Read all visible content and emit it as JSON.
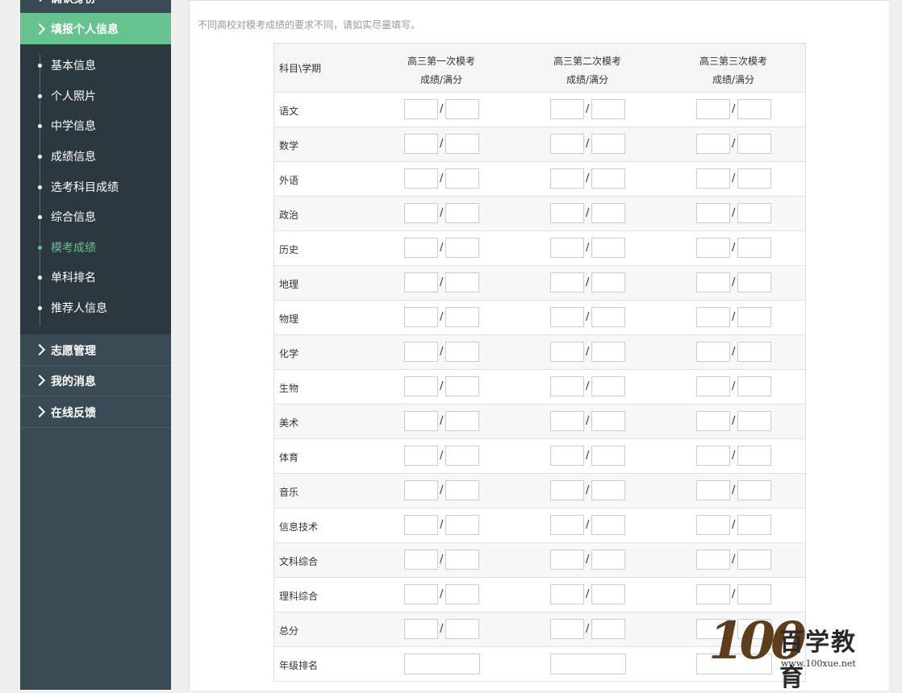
{
  "sidebar": {
    "top_partial": "确认身份",
    "active_section": "填报个人信息",
    "sub_items": [
      "基本信息",
      "个人照片",
      "中学信息",
      "成绩信息",
      "选考科目成绩",
      "综合信息",
      "模考成绩",
      "单科排名",
      "推荐人信息"
    ],
    "active_sub": "模考成绩",
    "menu": [
      "志愿管理",
      "我的消息",
      "在线反馈"
    ]
  },
  "main": {
    "note": "不同高校对模考成绩的要求不同，请如实尽量填写。",
    "table": {
      "corner": "科目\\学期",
      "columns": [
        {
          "line1": "高三第一次模考",
          "line2": "成绩/满分"
        },
        {
          "line1": "高三第二次模考",
          "line2": "成绩/满分"
        },
        {
          "line1": "高三第三次模考",
          "line2": "成绩/满分"
        }
      ],
      "separator": "/",
      "rows": [
        "语文",
        "数学",
        "外语",
        "政治",
        "历史",
        "地理",
        "物理",
        "化学",
        "生物",
        "美术",
        "体育",
        "音乐",
        "信息技术",
        "文科综合",
        "理科综合",
        "总分",
        "年级排名"
      ]
    }
  },
  "watermark": {
    "logo_number": "100",
    "brand": "百学教育",
    "url": "www.100xue.net"
  },
  "colors": {
    "accent": "#66c38f",
    "sidebar": "#3a4a54",
    "submenu": "#2b383f"
  }
}
